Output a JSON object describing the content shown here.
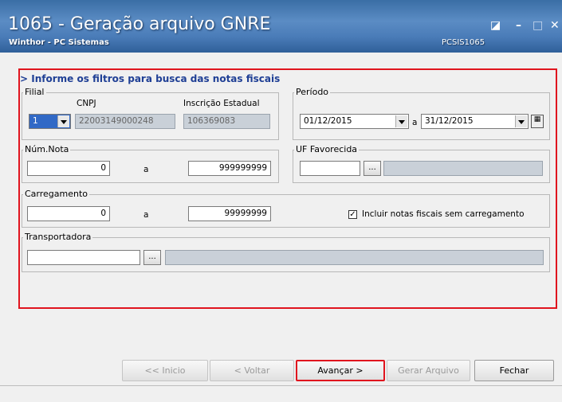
{
  "window": {
    "title": "1065 - Geração arquivo GNRE",
    "subtitle": "Winthor - PC Sistemas",
    "code": "PCSIS1065"
  },
  "header": "> Informe os filtros para busca das notas fiscais",
  "filial": {
    "group_label": "Filial",
    "value": "1",
    "cnpj_label": "CNPJ",
    "cnpj_value": "22003149000248",
    "ie_label": "Inscrição Estadual",
    "ie_value": "106369083"
  },
  "periodo": {
    "group_label": "Período",
    "start": "01/12/2015",
    "sep": "a",
    "end": "31/12/2015"
  },
  "num_nota": {
    "group_label": "Núm.Nota",
    "from": "0",
    "sep": "a",
    "to": "999999999"
  },
  "uf": {
    "group_label": "UF Favorecida",
    "value": "",
    "lookup": "...",
    "desc": ""
  },
  "carregamento": {
    "group_label": "Carregamento",
    "from": "0",
    "sep": "a",
    "to": "99999999",
    "checkbox_label": "Incluir notas fiscais sem carregamento",
    "checked": true
  },
  "transportadora": {
    "group_label": "Transportadora",
    "value": "",
    "lookup": "...",
    "desc": ""
  },
  "buttons": {
    "inicio": "<< Inicio",
    "voltar": "< Voltar",
    "avancar": "Avançar >",
    "gerar": "Gerar Arquivo",
    "fechar": "Fechar"
  },
  "colors": {
    "title_bg": "#4a7cb8",
    "highlight": "#e0141e",
    "header_text": "#1f3f95"
  }
}
